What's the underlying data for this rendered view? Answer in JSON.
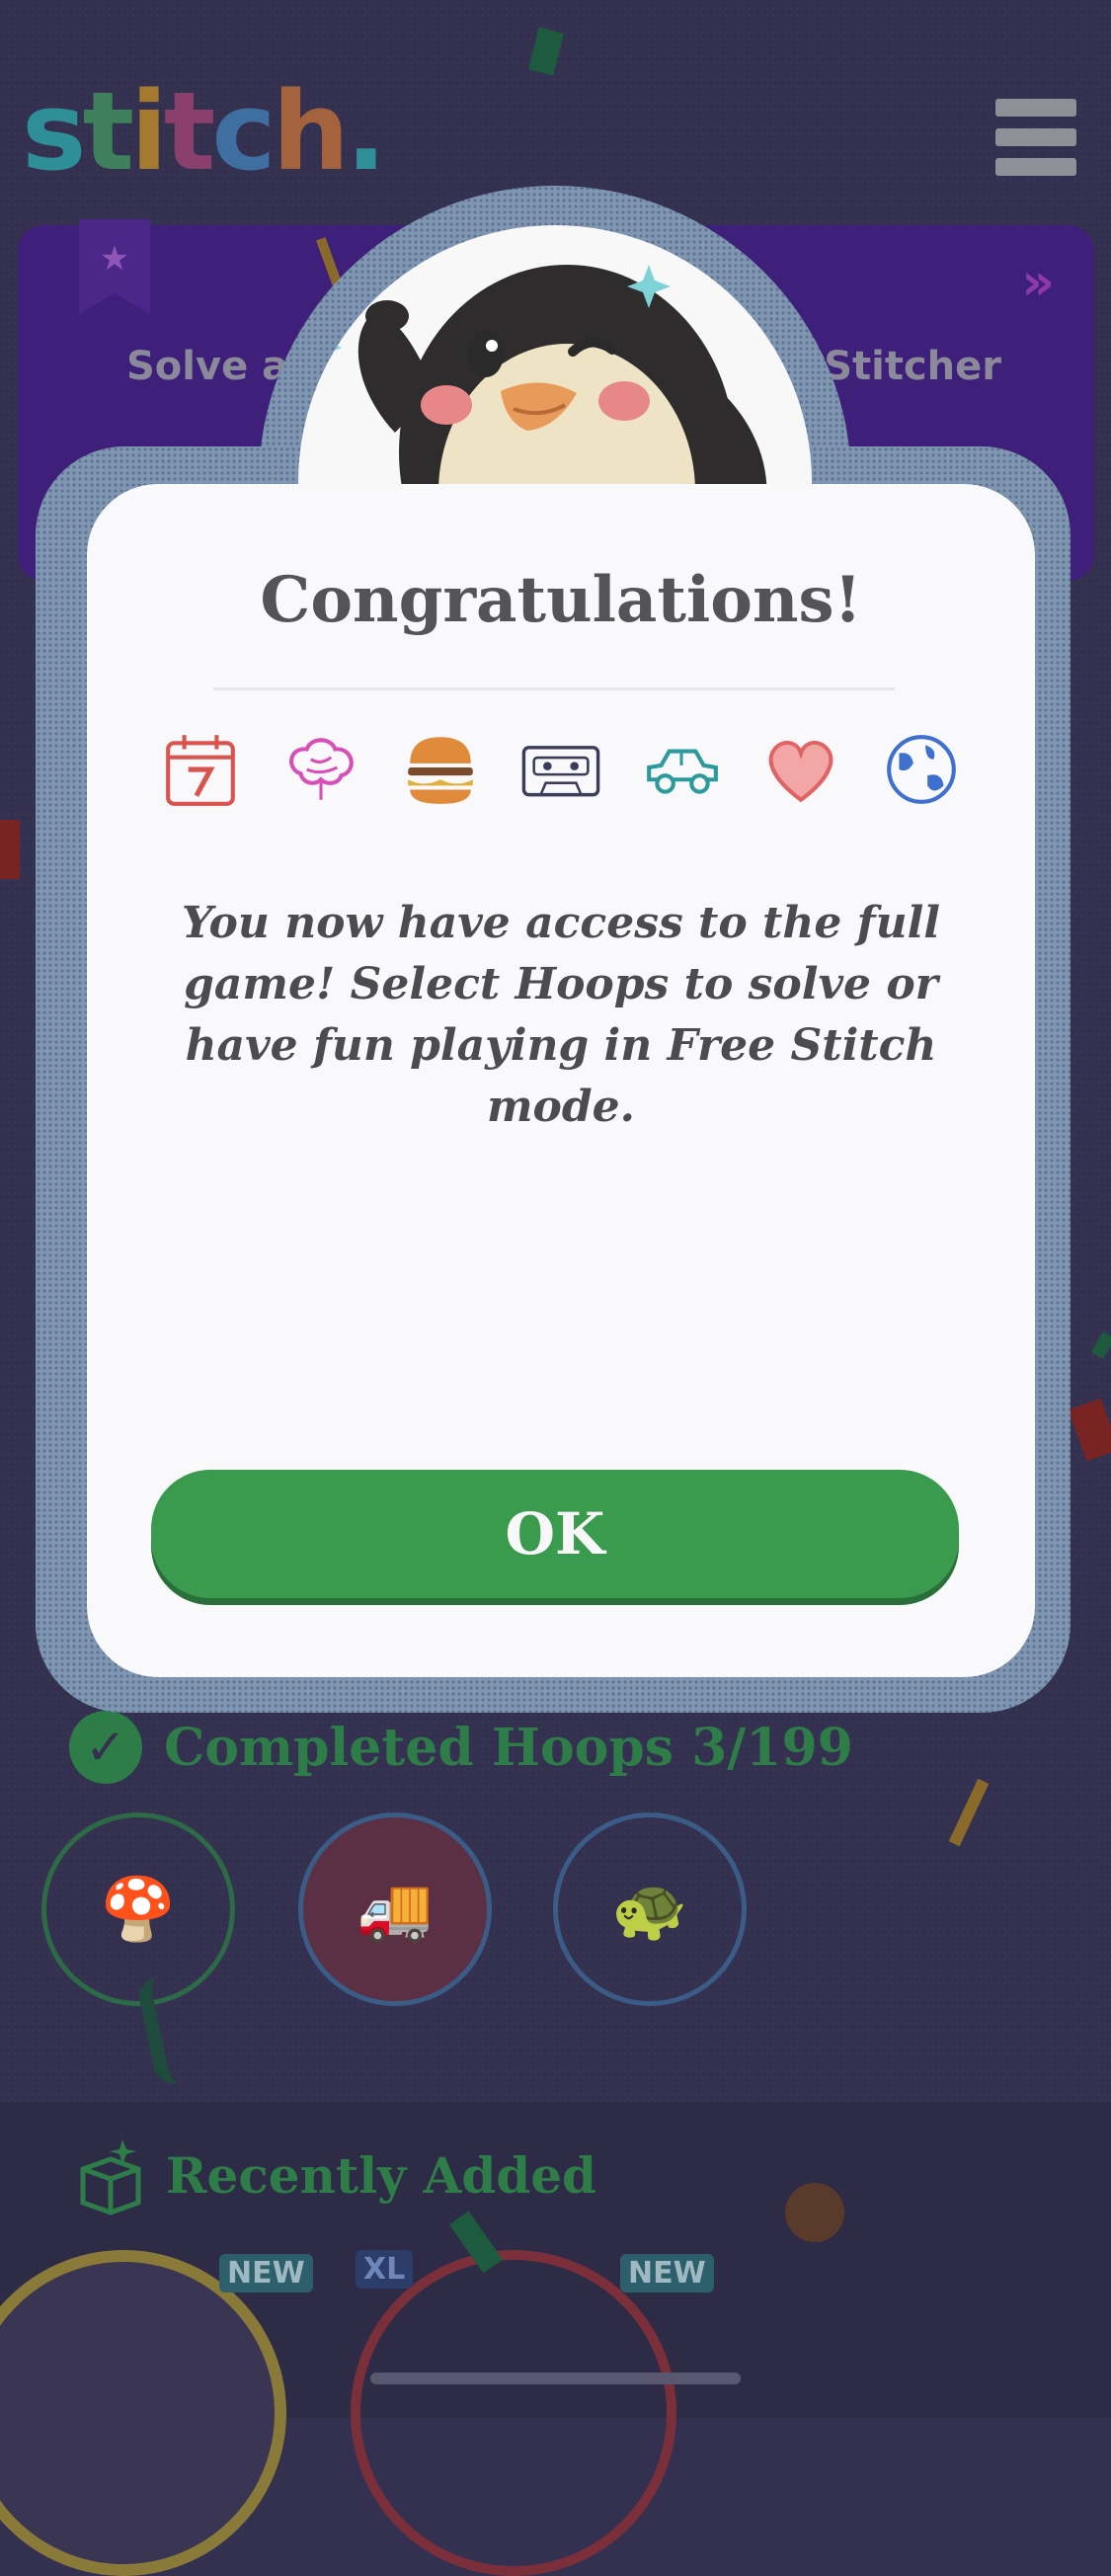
{
  "app": {
    "logo": "stitch."
  },
  "background": {
    "banner": {
      "text_left": "Solve ar",
      "text_right": "Stitcher"
    },
    "completed_label": "Completed Hoops 3/199",
    "recently_added_label": "Recently Added",
    "tags": [
      "NEW",
      "XL",
      "NEW"
    ]
  },
  "dialog": {
    "title": "Congratulations!",
    "icons": [
      "calendar-icon",
      "brain-icon",
      "burger-icon",
      "cassette-icon",
      "car-icon",
      "heart-icon",
      "globe-icon"
    ],
    "message": "You now have access to the full game! Select Hoops to solve or have fun playing in Free Stitch mode.",
    "ok_label": "OK"
  },
  "colors": {
    "ok_button": "#3a9a4e",
    "frame": "#7f96b3",
    "title_text": "#545456",
    "background": "#34304f"
  }
}
